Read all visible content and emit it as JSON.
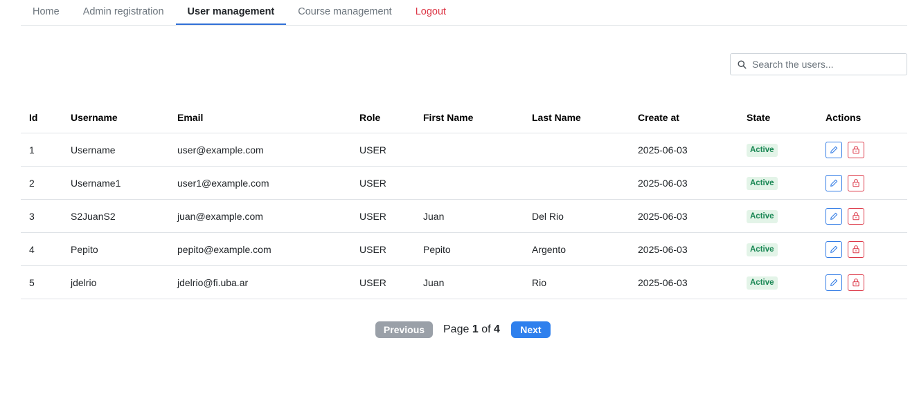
{
  "nav": {
    "tabs": [
      {
        "label": "Home"
      },
      {
        "label": "Admin registration"
      },
      {
        "label": "User management",
        "active": true
      },
      {
        "label": "Course management"
      },
      {
        "label": "Logout"
      }
    ]
  },
  "search": {
    "placeholder": "Search the users...",
    "value": ""
  },
  "table": {
    "headers": {
      "id": "Id",
      "username": "Username",
      "email": "Email",
      "role": "Role",
      "first_name": "First Name",
      "last_name": "Last Name",
      "created": "Create at",
      "state": "State",
      "actions": "Actions"
    },
    "rows": [
      {
        "id": "1",
        "username": "Username",
        "email": "user@example.com",
        "role": "USER",
        "first_name": "",
        "last_name": "",
        "created": "2025-06-03",
        "state": "Active"
      },
      {
        "id": "2",
        "username": "Username1",
        "email": "user1@example.com",
        "role": "USER",
        "first_name": "",
        "last_name": "",
        "created": "2025-06-03",
        "state": "Active"
      },
      {
        "id": "3",
        "username": "S2JuanS2",
        "email": "juan@example.com",
        "role": "USER",
        "first_name": "Juan",
        "last_name": "Del Rio",
        "created": "2025-06-03",
        "state": "Active"
      },
      {
        "id": "4",
        "username": "Pepito",
        "email": "pepito@example.com",
        "role": "USER",
        "first_name": "Pepito",
        "last_name": "Argento",
        "created": "2025-06-03",
        "state": "Active"
      },
      {
        "id": "5",
        "username": "jdelrio",
        "email": "jdelrio@fi.uba.ar",
        "role": "USER",
        "first_name": "Juan",
        "last_name": "Rio",
        "created": "2025-06-03",
        "state": "Active"
      }
    ],
    "action_icons": {
      "edit": "pencil-icon",
      "lock": "lock-icon"
    }
  },
  "pagination": {
    "previous_label": "Previous",
    "next_label": "Next",
    "page_word": "Page",
    "of_word": "of",
    "current_page": "1",
    "total_pages": "4"
  },
  "colors": {
    "active_tab_underline": "#2f6fd6",
    "logout": "#dc3545",
    "badge_bg": "#e3f4e8",
    "badge_text": "#198754",
    "edit_button": "#2f7ae5",
    "lock_button": "#dc3545",
    "previous_button": "#9aa0a8",
    "next_button": "#2f80ed"
  }
}
